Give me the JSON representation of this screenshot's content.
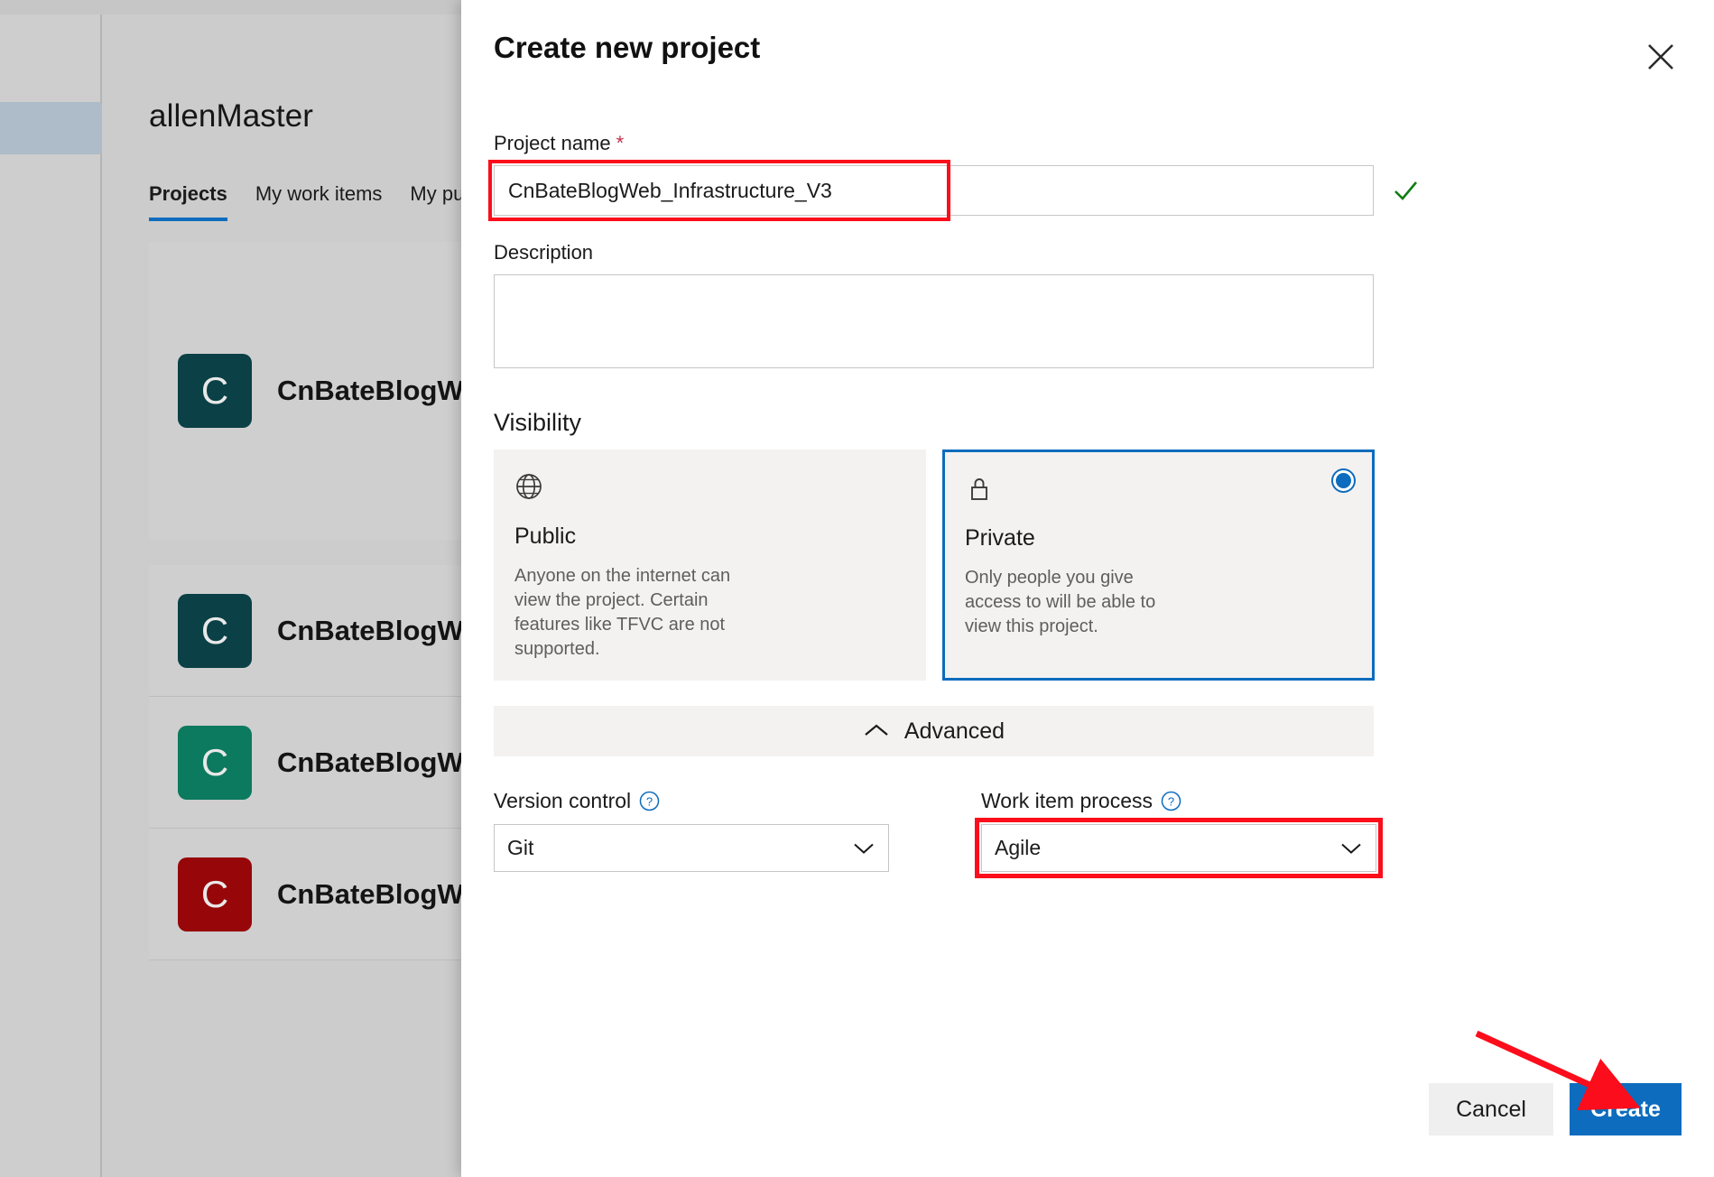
{
  "background": {
    "org_title": "allenMaster",
    "tabs": [
      {
        "label": "Projects",
        "active": true
      },
      {
        "label": "My work items",
        "active": false
      },
      {
        "label": "My pu",
        "active": false
      }
    ],
    "project_cards": [
      {
        "initial": "C",
        "name": "CnBateBlogWeb",
        "color": "#0a4046"
      },
      {
        "initial": "C",
        "name": "CnBateBlogWeb",
        "color": "#0a4046"
      },
      {
        "initial": "C",
        "name": "CnBateBlogWeb",
        "color": "#0b7a5e"
      },
      {
        "initial": "C",
        "name": "CnBateBlogWeb",
        "color": "#970608"
      }
    ]
  },
  "dialog": {
    "title": "Create new project",
    "close_label": "Close",
    "project_name": {
      "label": "Project name",
      "required_mark": "*",
      "value": "CnBateBlogWeb_Infrastructure_V3",
      "placeholder": "",
      "valid": true
    },
    "description": {
      "label": "Description",
      "value": "",
      "placeholder": ""
    },
    "visibility": {
      "label": "Visibility",
      "options": [
        {
          "id": "public",
          "icon": "globe-icon",
          "name": "Public",
          "description": "Anyone on the internet can view the project. Certain features like TFVC are not supported.",
          "selected": false
        },
        {
          "id": "private",
          "icon": "lock-icon",
          "name": "Private",
          "description": "Only people you give access to will be able to view this project.",
          "selected": true
        }
      ]
    },
    "advanced": {
      "label": "Advanced",
      "expanded": true,
      "icon": "chevron-up-icon"
    },
    "version_control": {
      "label": "Version control",
      "help_icon": "help-circle-icon",
      "value": "Git"
    },
    "work_item_process": {
      "label": "Work item process",
      "help_icon": "help-circle-icon",
      "value": "Agile"
    },
    "buttons": {
      "cancel": "Cancel",
      "create": "Create"
    }
  },
  "annotations": {
    "highlight_color": "#fc0d1b",
    "accent_color": "#0d6cbd"
  }
}
